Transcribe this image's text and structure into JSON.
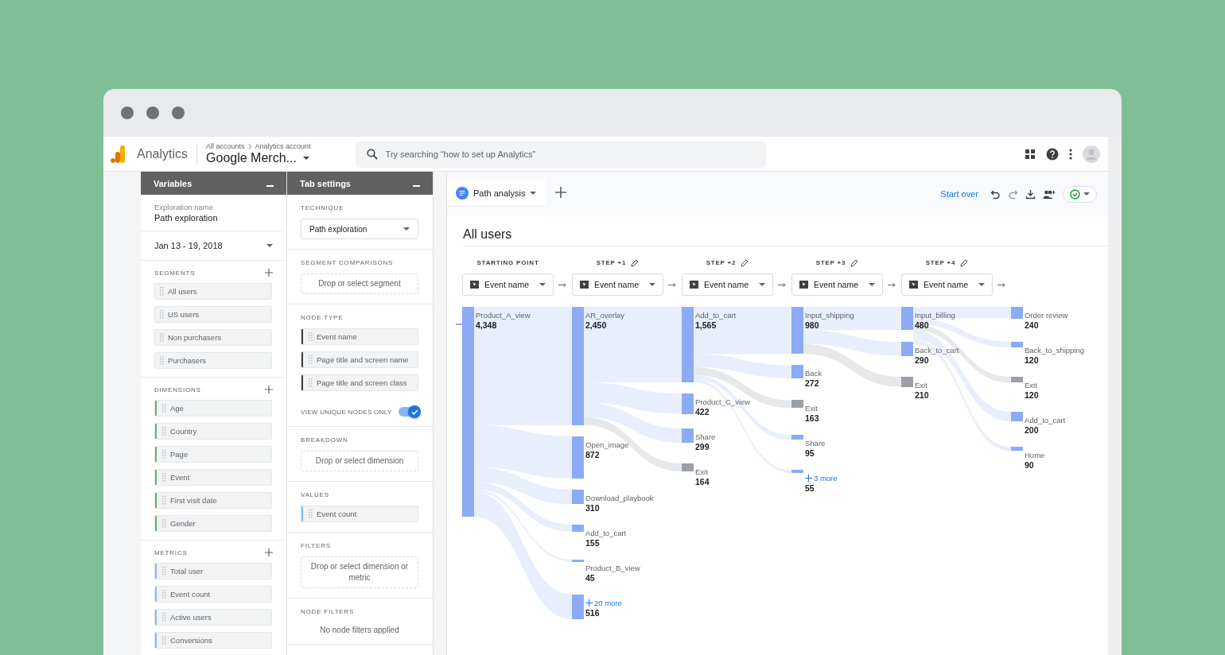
{
  "header": {
    "product": "Analytics",
    "breadcrumb": [
      "All accounts",
      "Analytics account"
    ],
    "property": "Google Merch...",
    "search": {
      "placeholder": "Try searching “how to set up Analytics”"
    }
  },
  "variables_panel": {
    "title": "Variables",
    "exploration_label": "Exploration name",
    "exploration_name": "Path exploration",
    "date_range": "Jan 13 - 19, 2018",
    "sections": [
      {
        "title": "SEGMENTS",
        "items": [
          "All users",
          "US users",
          "Non purchasers",
          "Purchasers"
        ]
      },
      {
        "title": "DIMENSIONS",
        "color": "#5bb974",
        "items": [
          "Age",
          "Country",
          "Page",
          "Event",
          "First visit date",
          "Gender"
        ]
      },
      {
        "title": "METRICS",
        "color": "#8ab4f8",
        "items": [
          "Total user",
          "Event count",
          "Active users",
          "Conversions"
        ]
      }
    ]
  },
  "tab_settings": {
    "title": "Tab settings",
    "sections": [
      {
        "title": "TECHNIQUE",
        "kind": "select",
        "value": "Path exploration"
      },
      {
        "title": "SEGMENT COMPARISONS",
        "kind": "dropzone",
        "placeholder": "Drop or select segment"
      },
      {
        "title": "NODE TYPE",
        "kind": "chips",
        "color": "#3c4043",
        "items": [
          "Event name",
          "Page title and screen name",
          "Page title and screen class"
        ],
        "toggle": {
          "label": "VIEW UNIQUE NODES ONLY",
          "on": true
        }
      },
      {
        "title": "BREAKDOWN",
        "kind": "dropzone",
        "placeholder": "Drop or select dimension"
      },
      {
        "title": "VALUES",
        "kind": "chips",
        "color": "#8ab4f8",
        "items": [
          "Event count"
        ]
      },
      {
        "title": "FILTERS",
        "kind": "dropzone",
        "placeholder": "Drop or select dimension or metric"
      },
      {
        "title": "NODE FILTERS",
        "kind": "note",
        "text": "No node filters applied"
      }
    ]
  },
  "exploration": {
    "tabs": [
      {
        "label": "Path analysis",
        "selected": true
      }
    ],
    "start_over": "Start over",
    "title": "All users",
    "steps": [
      {
        "heading": "STARTING POINT",
        "editable": false,
        "node_type": "Event name",
        "nodes": [
          {
            "label": "Product_A_view",
            "value": "4,348",
            "kind": "event"
          }
        ]
      },
      {
        "heading": "STEP +1",
        "editable": true,
        "node_type": "Event name",
        "nodes": [
          {
            "label": "AR_overlay",
            "value": "2,450",
            "kind": "event"
          },
          {
            "label": "Open_image",
            "value": "872",
            "kind": "event"
          },
          {
            "label": "Download_playbook",
            "value": "310",
            "kind": "event"
          },
          {
            "label": "Add_to_cart",
            "value": "155",
            "kind": "event"
          },
          {
            "label": "Product_B_view",
            "value": "45",
            "kind": "event"
          },
          {
            "label": "20 more",
            "value": "516",
            "kind": "more"
          }
        ]
      },
      {
        "heading": "STEP +2",
        "editable": true,
        "node_type": "Event name",
        "nodes": [
          {
            "label": "Add_to_cart",
            "value": "1,565",
            "kind": "event"
          },
          {
            "label": "Product_C_view",
            "value": "422",
            "kind": "event"
          },
          {
            "label": "Share",
            "value": "299",
            "kind": "event"
          },
          {
            "label": "Exit",
            "value": "164",
            "kind": "exit"
          }
        ]
      },
      {
        "heading": "STEP +3",
        "editable": true,
        "node_type": "Event name",
        "nodes": [
          {
            "label": "Input_shipping",
            "value": "980",
            "kind": "event"
          },
          {
            "label": "Back",
            "value": "272",
            "kind": "event"
          },
          {
            "label": "Exit",
            "value": "163",
            "kind": "exit"
          },
          {
            "label": "Share",
            "value": "95",
            "kind": "event"
          },
          {
            "label": "3 more",
            "value": "55",
            "kind": "more"
          }
        ]
      },
      {
        "heading": "STEP +4",
        "editable": true,
        "node_type": "Event name",
        "nodes": [
          {
            "label": "Input_billing",
            "value": "480",
            "kind": "event"
          },
          {
            "label": "Back_to_cart",
            "value": "290",
            "kind": "event"
          },
          {
            "label": "Exit",
            "value": "210",
            "kind": "exit"
          }
        ]
      },
      {
        "nodes": [
          {
            "label": "Order review",
            "value": "240",
            "kind": "event"
          },
          {
            "label": "Back_to_shipping",
            "value": "120",
            "kind": "event"
          },
          {
            "label": "Exit",
            "value": "120",
            "kind": "exit"
          },
          {
            "label": "Add_to_cart",
            "value": "200",
            "kind": "event"
          },
          {
            "label": "Home",
            "value": "90",
            "kind": "event"
          }
        ]
      }
    ]
  }
}
